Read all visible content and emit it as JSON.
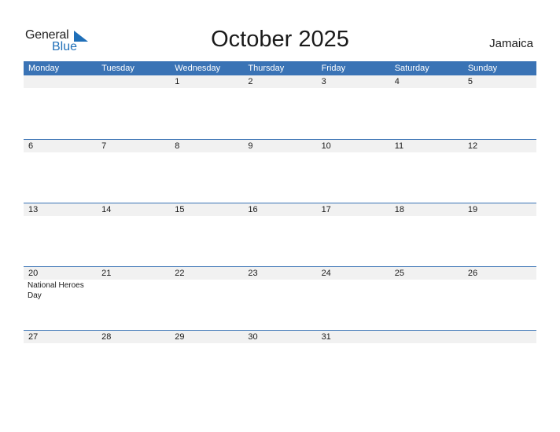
{
  "brand": {
    "general": "General",
    "blue": "Blue",
    "accent_color": "#3a73b5"
  },
  "title": "October 2025",
  "country": "Jamaica",
  "weekdays": [
    "Monday",
    "Tuesday",
    "Wednesday",
    "Thursday",
    "Friday",
    "Saturday",
    "Sunday"
  ],
  "weeks": [
    [
      {
        "day": "",
        "holiday": ""
      },
      {
        "day": "",
        "holiday": ""
      },
      {
        "day": "1",
        "holiday": ""
      },
      {
        "day": "2",
        "holiday": ""
      },
      {
        "day": "3",
        "holiday": ""
      },
      {
        "day": "4",
        "holiday": ""
      },
      {
        "day": "5",
        "holiday": ""
      }
    ],
    [
      {
        "day": "6",
        "holiday": ""
      },
      {
        "day": "7",
        "holiday": ""
      },
      {
        "day": "8",
        "holiday": ""
      },
      {
        "day": "9",
        "holiday": ""
      },
      {
        "day": "10",
        "holiday": ""
      },
      {
        "day": "11",
        "holiday": ""
      },
      {
        "day": "12",
        "holiday": ""
      }
    ],
    [
      {
        "day": "13",
        "holiday": ""
      },
      {
        "day": "14",
        "holiday": ""
      },
      {
        "day": "15",
        "holiday": ""
      },
      {
        "day": "16",
        "holiday": ""
      },
      {
        "day": "17",
        "holiday": ""
      },
      {
        "day": "18",
        "holiday": ""
      },
      {
        "day": "19",
        "holiday": ""
      }
    ],
    [
      {
        "day": "20",
        "holiday": "National Heroes Day"
      },
      {
        "day": "21",
        "holiday": ""
      },
      {
        "day": "22",
        "holiday": ""
      },
      {
        "day": "23",
        "holiday": ""
      },
      {
        "day": "24",
        "holiday": ""
      },
      {
        "day": "25",
        "holiday": ""
      },
      {
        "day": "26",
        "holiday": ""
      }
    ],
    [
      {
        "day": "27",
        "holiday": ""
      },
      {
        "day": "28",
        "holiday": ""
      },
      {
        "day": "29",
        "holiday": ""
      },
      {
        "day": "30",
        "holiday": ""
      },
      {
        "day": "31",
        "holiday": ""
      },
      {
        "day": "",
        "holiday": ""
      },
      {
        "day": "",
        "holiday": ""
      }
    ]
  ]
}
